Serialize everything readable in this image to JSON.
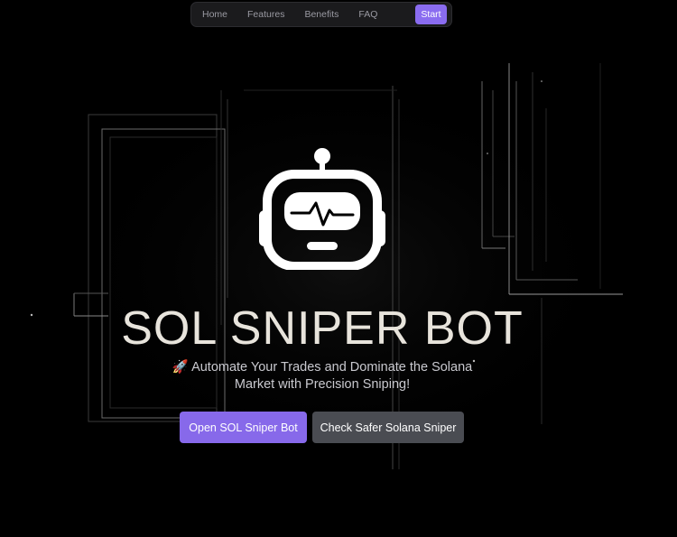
{
  "nav": {
    "items": [
      "Home",
      "Features",
      "Benefits",
      "FAQ"
    ],
    "start_label": "Start"
  },
  "hero": {
    "logo_icon": "robot-head-icon",
    "title": "SOL SNIPER BOT",
    "subtitle_emoji": "🚀",
    "subtitle": "Automate Your Trades and Dominate the Solana Market with Precision Sniping!",
    "primary_button": "Open SOL Sniper Bot",
    "secondary_button": "Check Safer Solana Sniper"
  },
  "colors": {
    "background": "#000000",
    "accent": "#8769ea",
    "secondary_button": "#4a4c52",
    "title": "#e8e4dc"
  }
}
